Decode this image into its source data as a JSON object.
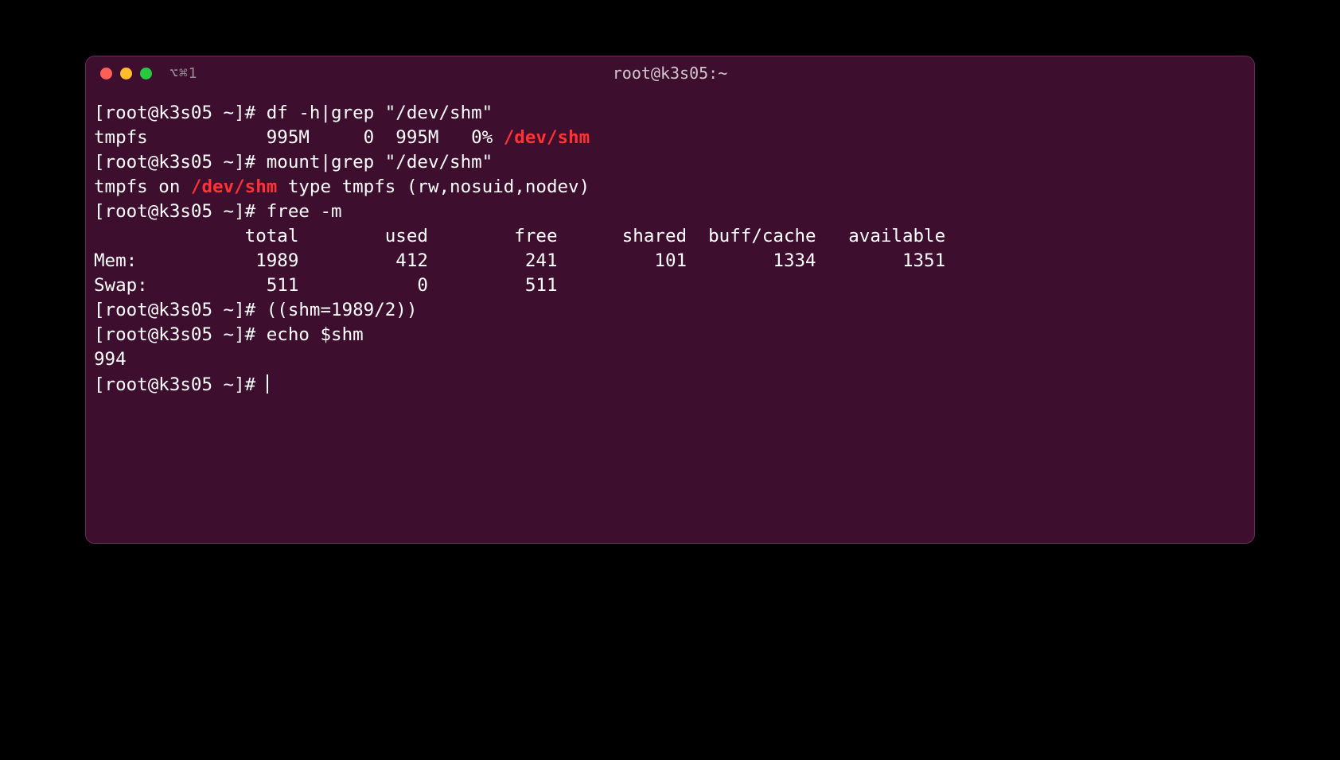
{
  "window": {
    "tab_label": "⌥⌘1",
    "title": "root@k3s05:~"
  },
  "prompt": "[root@k3s05 ~]# ",
  "commands": {
    "cmd1": "df -h|grep \"/dev/shm\"",
    "out1_a": "tmpfs           995M     0  995M   0% ",
    "out1_hl": "/dev/shm",
    "cmd2": "mount|grep \"/dev/shm\"",
    "out2_a": "tmpfs on ",
    "out2_hl": "/dev/shm",
    "out2_b": " type tmpfs (rw,nosuid,nodev)",
    "cmd3": "free -m",
    "out3_header": "              total        used        free      shared  buff/cache   available",
    "out3_mem": "Mem:           1989         412         241         101        1334        1351",
    "out3_swap": "Swap:           511           0         511",
    "cmd4": "((shm=1989/2))",
    "cmd5": "echo $shm",
    "out5": "994"
  }
}
